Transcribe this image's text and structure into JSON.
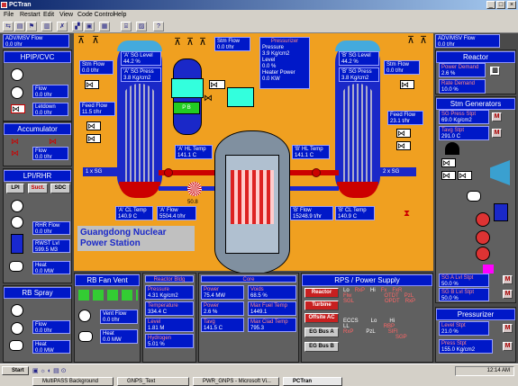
{
  "window": {
    "title": "PCTran",
    "controls": [
      "_",
      "□",
      "×"
    ]
  },
  "menu": [
    "File",
    "Restart",
    "Edit",
    "View",
    "Code Control",
    "Help"
  ],
  "toolbar": [
    "⇆",
    "▤",
    "⚑",
    "▥",
    "✗",
    "▞",
    "▣",
    "▦",
    "⌸",
    "▨",
    "?"
  ],
  "left": {
    "adv_msv": {
      "title": "ADV/MSV Flow",
      "value": "0.0",
      "unit": "t/hr"
    },
    "hpip": {
      "title": "HPIP/CVC",
      "flow_label": "Flow",
      "flow": "0.0",
      "flow_unit": "t/hr",
      "letdown_label": "Letdown",
      "letdown": "0.0",
      "letdown_unit": "t/hr"
    },
    "accumulator": {
      "title": "Accumulator",
      "flow_label": "Flow",
      "flow": "0.0",
      "flow_unit": "t/hr"
    },
    "lpi": {
      "title": "LPI/RHR",
      "tabs": [
        "LPI",
        "Suct.",
        "SDC"
      ],
      "rhr_label": "RHR Flow",
      "rhr": "0.0",
      "rhr_unit": "t/hr",
      "rwst_label": "RWST Lvl",
      "rwst": "599.5",
      "rwst_unit": "M3",
      "heat_label": "Heat",
      "heat": "0.0",
      "heat_unit": "MW"
    },
    "rb_spray": {
      "title": "RB Spray",
      "flow_label": "Flow",
      "flow": "0.0",
      "flow_unit": "t/hr",
      "heat_label": "Heat",
      "heat": "0.0",
      "heat_unit": "MW"
    }
  },
  "plant": {
    "sg_a": {
      "level_label": "'A' SG Level",
      "level": "44.2",
      "level_unit": "%",
      "press_label": "'A' SG Press",
      "press": "3.8",
      "press_unit": "Kg/cm2",
      "tag": "1 x SG"
    },
    "sg_b": {
      "level_label": "'B' SG Level",
      "level": "44.2",
      "level_unit": "%",
      "press_label": "'B' SG Press",
      "press": "3.8",
      "press_unit": "Kg/cm2",
      "tag": "2 x SG"
    },
    "stm_flow_a": {
      "label": "Stm Flow",
      "value": "0.0",
      "unit": "t/hr"
    },
    "stm_flow_b": {
      "label": "Stm Flow",
      "value": "0.0",
      "unit": "t/hr"
    },
    "stm_flow_top": {
      "label": "Stm Flow",
      "value": "0.0",
      "unit": "t/hr"
    },
    "feed_a": {
      "label": "Feed Flow",
      "value": "11.5",
      "unit": "t/hr"
    },
    "feed_b": {
      "label": "Feed Flow",
      "value": "23.1",
      "unit": "t/hr"
    },
    "pressurizer": {
      "title": "Pressurizer",
      "press_label": "Pressure",
      "press": "3.9",
      "press_unit": "Kg/cm2",
      "level_label": "Level",
      "level": "0.0",
      "level_unit": "%",
      "heater_label": "Heater Power",
      "heater": "0.0",
      "heater_unit": "KW"
    },
    "a_hl": {
      "label": "'A' HL Temp",
      "value": "141.1",
      "unit": "C"
    },
    "b_hl": {
      "label": "'B' HL Temp",
      "value": "141.1",
      "unit": "C"
    },
    "a_cl": {
      "label": "'A' CL Temp",
      "value": "140.9",
      "unit": "C"
    },
    "a_flow": {
      "label": "'A' Flow",
      "value": "5504.4",
      "unit": "t/hr"
    },
    "b_flow": {
      "label": "'B' Flow",
      "value": "15248.9",
      "unit": "t/hr"
    },
    "b_cl": {
      "label": "'B' CL Temp",
      "value": "140.9",
      "unit": "C"
    },
    "rcp_a_value": "50.8",
    "caption": "Guangdong Nuclear Power Station",
    "pb_label": "P  B"
  },
  "right": {
    "adv_msv": {
      "title": "ADV/MSV Flow",
      "value": "0.0",
      "unit": "t/hr"
    },
    "reactor": {
      "title": "Reactor",
      "power_label": "Power Demand",
      "power": "2.6",
      "power_unit": "%",
      "rate_label": "Rate Demand",
      "rate": "10.0",
      "rate_unit": "%"
    },
    "stm_gen": {
      "title": "Stm Generators",
      "sg_press_label": "SG Press Stpt",
      "sg_press": "69.0",
      "sg_press_unit": "Kg/cm2",
      "tavg_label": "Tavg Stpt",
      "tavg": "291.0",
      "tavg_unit": "C",
      "sga_label": "SG A Lvl Stpt",
      "sga": "50.0",
      "sga_unit": "%",
      "sgb_label": "SG B Lvl Stpt",
      "sgb": "50.0",
      "sgb_unit": "%",
      "m": "M"
    },
    "pressurizer": {
      "title": "Pressurizer",
      "level_label": "Level Stpt",
      "level": "21.0",
      "level_unit": "%",
      "press_label": "Press Stpt",
      "press": "155.0",
      "press_unit": "Kg/cm2"
    }
  },
  "bottom": {
    "rb_fan": {
      "title": "RB Fan  Vent",
      "vent_label": "Vent Flow",
      "vent": "0.0",
      "vent_unit": "t/hr",
      "heat_label": "Heat",
      "heat": "0.0",
      "heat_unit": "MW"
    },
    "reactor_bldg": {
      "title": "Reactor Bldg",
      "press_label": "Pressure",
      "press": "4.31",
      "press_unit": "Kg/cm2",
      "temp_label": "Temperature",
      "temp": "334.4",
      "temp_unit": "C",
      "level_label": "Level",
      "level": "1.81",
      "level_unit": "M",
      "h2_label": "Hydrogen",
      "h2": "5.01",
      "h2_unit": "%"
    },
    "core": {
      "title": "Core",
      "power1_label": "Power",
      "power1": "75.4",
      "power1_unit": "MW",
      "voids_label": "Voids",
      "voids": "68.5",
      "voids_unit": "%",
      "power2_label": "Power",
      "power2": "2.6",
      "power2_unit": "%",
      "maxfuel_label": "Max Fuel Temp",
      "maxfuel": "1449.1",
      "tavg_label": "Tavg",
      "tavg": "141.5",
      "tavg_unit": "C",
      "maxclad_label": "Max Clad Temp",
      "maxclad": "795.3"
    },
    "rps": {
      "title": "RPS / Power Supply",
      "buttons": [
        "Reactor",
        "Turbine",
        "Offsite AC",
        "EG Bus A",
        "EG Bus B"
      ],
      "row1": [
        "Lo",
        "RxP",
        "Hi",
        "Fx",
        "FxR"
      ],
      "row2": [
        "Flw",
        "",
        "",
        "OTDT",
        "PzL"
      ],
      "row3": [
        "SGL",
        "",
        "",
        "OPDT",
        "RxP"
      ],
      "eccs_title": "ECCS",
      "eccs_lo": "Lo",
      "eccs_hi": "Hi",
      "eccs1": [
        "LL",
        "",
        "RBP"
      ],
      "eccs2": [
        "RxP",
        "PzL",
        "SIFI"
      ],
      "eccs3": [
        "",
        "",
        "SGP"
      ]
    }
  },
  "taskbar": {
    "start": "Start",
    "tasks": [
      "MultiPASS Background",
      "GNPS_Text",
      "PWR_GNPS - Microsoft Vi...",
      "PCTran"
    ],
    "clock": "12:14 AM"
  }
}
